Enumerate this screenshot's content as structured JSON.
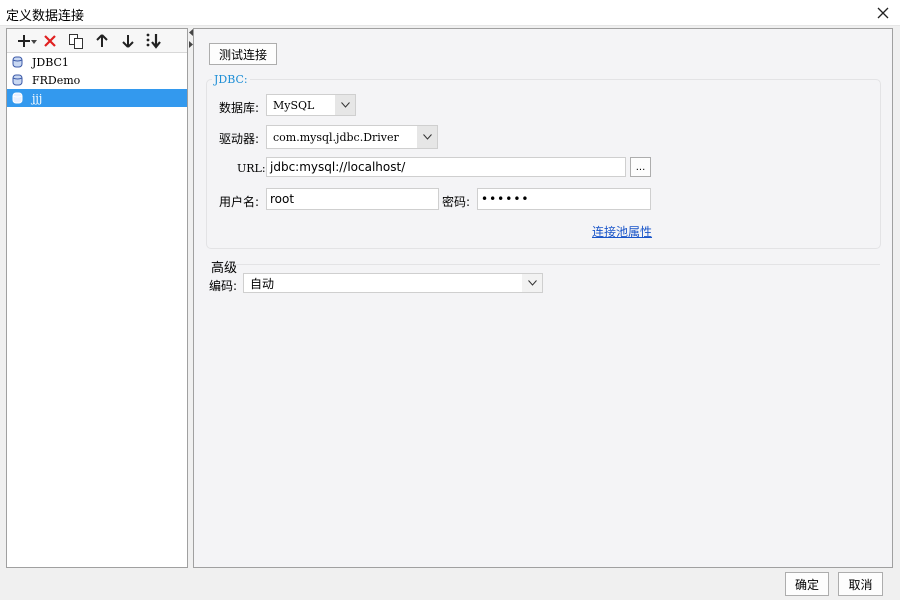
{
  "window": {
    "title": "定义数据连接"
  },
  "toolbar": {
    "icons": [
      "plus-icon",
      "chevron-down-icon",
      "delete-icon",
      "copy-icon",
      "arrow-up-icon",
      "arrow-down-icon",
      "sort-icon"
    ]
  },
  "connections": [
    {
      "name": "JDBC1",
      "selected": false
    },
    {
      "name": "FRDemo",
      "selected": false
    },
    {
      "name": "jjj",
      "selected": true
    }
  ],
  "test_button": {
    "label": "测试连接"
  },
  "jdbc": {
    "legend": "JDBC:",
    "database_label": "数据库:",
    "database_value": "MySQL",
    "driver_label": "驱动器:",
    "driver_value": "com.mysql.jdbc.Driver",
    "url_label": "URL:",
    "url_value": "jdbc:mysql://localhost/",
    "url_browse_label": "...",
    "username_label": "用户名:",
    "username_value": "root",
    "password_label": "密码:",
    "password_value": "••••••",
    "pool_link": "连接池属性"
  },
  "advanced": {
    "title": "高级",
    "encoding_label": "编码:",
    "encoding_value": "自动"
  },
  "footer": {
    "ok_label": "确定",
    "cancel_label": "取消"
  },
  "colors": {
    "selection": "#3399ee",
    "legend": "#1f8fd6",
    "link": "#1a55c9",
    "delete": "#e02020"
  }
}
